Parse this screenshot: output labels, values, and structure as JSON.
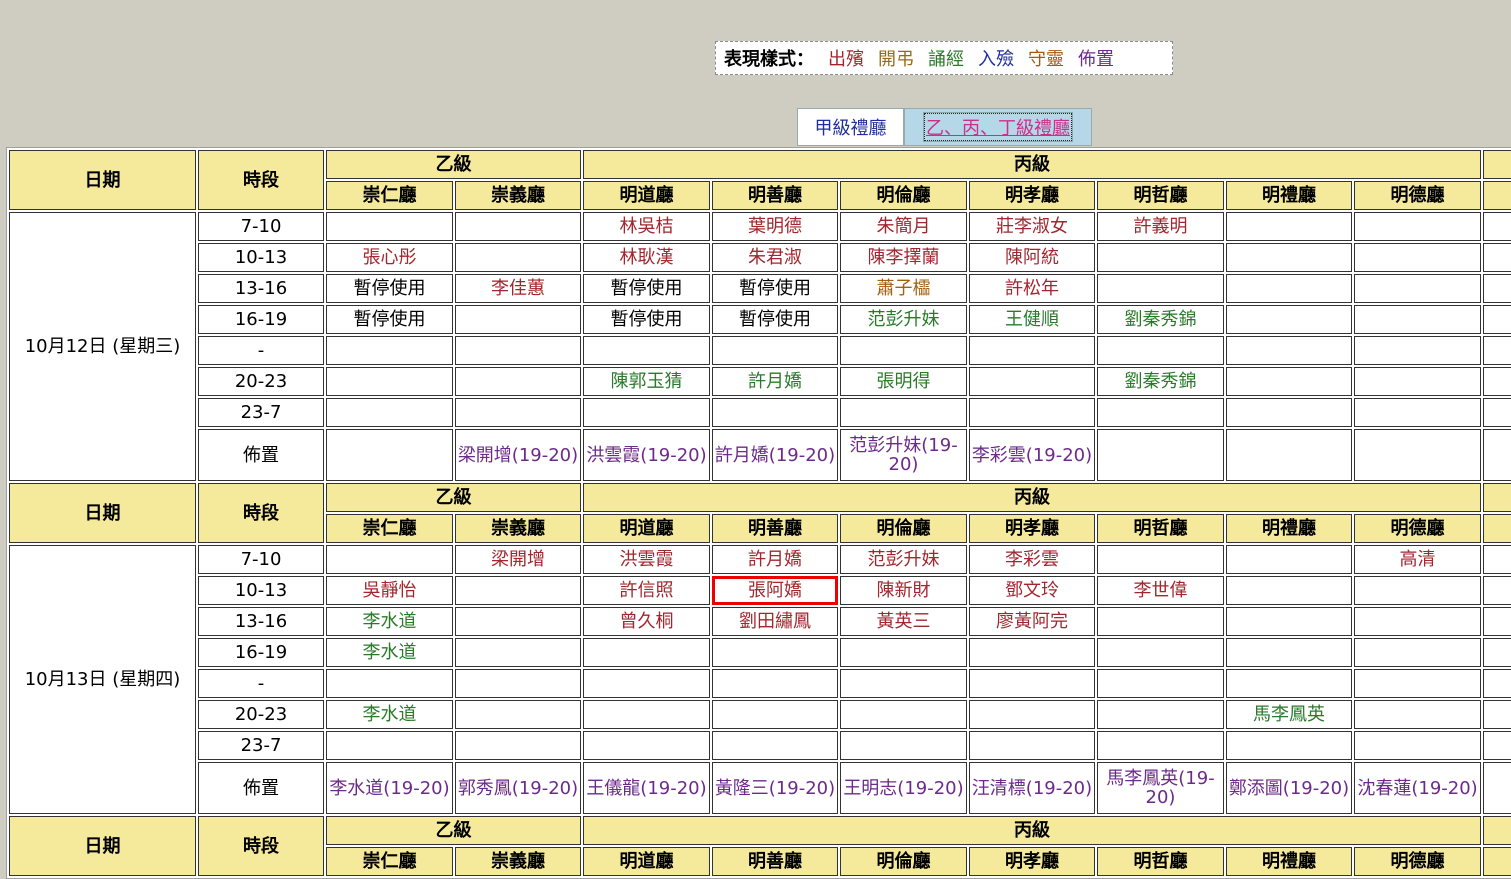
{
  "legend": {
    "title": "表現樣式：",
    "items": [
      {
        "label": "出殯",
        "color": "#a2262e"
      },
      {
        "label": "開弔",
        "color": "#9a6a10"
      },
      {
        "label": "誦經",
        "color": "#2a7a2a"
      },
      {
        "label": "入殮",
        "color": "#1f2e9a"
      },
      {
        "label": "守靈",
        "color": "#a45a0f"
      },
      {
        "label": "佈置",
        "color": "#6c2a8a"
      }
    ]
  },
  "tabs": [
    "甲級禮廳",
    "乙、丙、丁級禮廳"
  ],
  "header": {
    "date": "日期",
    "slot": "時段",
    "groups": [
      "乙級",
      "丙級"
    ],
    "halls": [
      "崇仁廳",
      "崇義廳",
      "明道廳",
      "明善廳",
      "明倫廳",
      "明孝廳",
      "明哲廳",
      "明禮廳",
      "明德廳"
    ]
  },
  "colors": {
    "red": "#a2262e",
    "orange": "#a4600f",
    "green": "#2a7a2a",
    "purple": "#6c2a8a",
    "black": "#000000",
    "highlight": "#e00000",
    "header_bg": "#f5ea9c"
  },
  "days": [
    {
      "date": "10月12日 (星期三)",
      "rows": [
        {
          "slot": "7-10",
          "cells": [
            null,
            null,
            {
              "t": "林吳桔",
              "c": "red"
            },
            {
              "t": "葉明德",
              "c": "red"
            },
            {
              "t": "朱簡月",
              "c": "red"
            },
            {
              "t": "莊李淑女",
              "c": "red"
            },
            {
              "t": "許義明",
              "c": "red"
            },
            null,
            null
          ]
        },
        {
          "slot": "10-13",
          "cells": [
            {
              "t": "張心彤",
              "c": "red"
            },
            null,
            {
              "t": "林耿漢",
              "c": "red"
            },
            {
              "t": "朱君淑",
              "c": "red"
            },
            {
              "t": "陳李擇蘭",
              "c": "red"
            },
            {
              "t": "陳阿統",
              "c": "red"
            },
            null,
            null,
            null
          ]
        },
        {
          "slot": "13-16",
          "cells": [
            {
              "t": "暫停使用",
              "c": "black"
            },
            {
              "t": "李佳蕙",
              "c": "red"
            },
            {
              "t": "暫停使用",
              "c": "black"
            },
            {
              "t": "暫停使用",
              "c": "black"
            },
            {
              "t": "蕭子櫺",
              "c": "orange"
            },
            {
              "t": "許松年",
              "c": "red"
            },
            null,
            null,
            null
          ]
        },
        {
          "slot": "16-19",
          "cells": [
            {
              "t": "暫停使用",
              "c": "black"
            },
            null,
            {
              "t": "暫停使用",
              "c": "black"
            },
            {
              "t": "暫停使用",
              "c": "black"
            },
            {
              "t": "范彭升妹",
              "c": "green"
            },
            {
              "t": "王健順",
              "c": "green"
            },
            {
              "t": "劉秦秀錦",
              "c": "green"
            },
            null,
            null
          ]
        },
        {
          "slot": "-",
          "cells": [
            null,
            null,
            null,
            null,
            null,
            null,
            null,
            null,
            null
          ]
        },
        {
          "slot": "20-23",
          "cells": [
            null,
            null,
            {
              "t": "陳郭玉猜",
              "c": "green"
            },
            {
              "t": "許月嬌",
              "c": "green"
            },
            {
              "t": "張明得",
              "c": "green"
            },
            null,
            {
              "t": "劉秦秀錦",
              "c": "green"
            },
            null,
            null
          ]
        },
        {
          "slot": "23-7",
          "cells": [
            null,
            null,
            null,
            null,
            null,
            null,
            null,
            null,
            null
          ]
        },
        {
          "slot": "佈置",
          "decor": true,
          "cells": [
            null,
            {
              "t": "梁開增(19-20)",
              "c": "purple"
            },
            {
              "t": "洪雲霞(19-20)",
              "c": "purple"
            },
            {
              "t": "許月嬌(19-20)",
              "c": "purple"
            },
            {
              "t": "范彭升妹(19-20)",
              "c": "purple"
            },
            {
              "t": "李彩雲(19-20)",
              "c": "purple"
            },
            null,
            null,
            null
          ]
        }
      ]
    },
    {
      "date": "10月13日 (星期四)",
      "rows": [
        {
          "slot": "7-10",
          "cells": [
            null,
            {
              "t": "梁開增",
              "c": "red"
            },
            {
              "t": "洪雲霞",
              "c": "red"
            },
            {
              "t": "許月嬌",
              "c": "red"
            },
            {
              "t": "范彭升妹",
              "c": "red"
            },
            {
              "t": "李彩雲",
              "c": "red"
            },
            null,
            null,
            {
              "t": "高清",
              "c": "red"
            }
          ]
        },
        {
          "slot": "10-13",
          "cells": [
            {
              "t": "吳靜怡",
              "c": "red"
            },
            null,
            {
              "t": "許信照",
              "c": "red"
            },
            {
              "t": "張阿嬌",
              "c": "red",
              "hl": true
            },
            {
              "t": "陳新財",
              "c": "red"
            },
            {
              "t": "鄧文玲",
              "c": "red"
            },
            {
              "t": "李世偉",
              "c": "red"
            },
            null,
            null
          ]
        },
        {
          "slot": "13-16",
          "cells": [
            {
              "t": "李水道",
              "c": "green"
            },
            null,
            {
              "t": "曾久桐",
              "c": "red"
            },
            {
              "t": "劉田繡鳳",
              "c": "red"
            },
            {
              "t": "黃英三",
              "c": "red"
            },
            {
              "t": "廖黃阿完",
              "c": "red"
            },
            null,
            null,
            null
          ]
        },
        {
          "slot": "16-19",
          "cells": [
            {
              "t": "李水道",
              "c": "green"
            },
            null,
            null,
            null,
            null,
            null,
            null,
            null,
            null
          ]
        },
        {
          "slot": "-",
          "cells": [
            null,
            null,
            null,
            null,
            null,
            null,
            null,
            null,
            null
          ]
        },
        {
          "slot": "20-23",
          "cells": [
            {
              "t": "李水道",
              "c": "green"
            },
            null,
            null,
            null,
            null,
            null,
            null,
            {
              "t": "馬李鳳英",
              "c": "green"
            },
            null
          ]
        },
        {
          "slot": "23-7",
          "cells": [
            null,
            null,
            null,
            null,
            null,
            null,
            null,
            null,
            null
          ]
        },
        {
          "slot": "佈置",
          "decor": true,
          "cells": [
            {
              "t": "李水道(19-20)",
              "c": "purple"
            },
            {
              "t": "郭秀鳳(19-20)",
              "c": "purple"
            },
            {
              "t": "王儀龍(19-20)",
              "c": "purple"
            },
            {
              "t": "黃隆三(19-20)",
              "c": "purple"
            },
            {
              "t": "王明志(19-20)",
              "c": "purple"
            },
            {
              "t": "汪清標(19-20)",
              "c": "purple"
            },
            {
              "t": "馬李鳳英(19-20)",
              "c": "purple"
            },
            {
              "t": "鄭添圖(19-20)",
              "c": "purple"
            },
            {
              "t": "沈春蓮(19-20)",
              "c": "purple"
            }
          ]
        }
      ]
    },
    {
      "date": "",
      "rows": []
    }
  ]
}
